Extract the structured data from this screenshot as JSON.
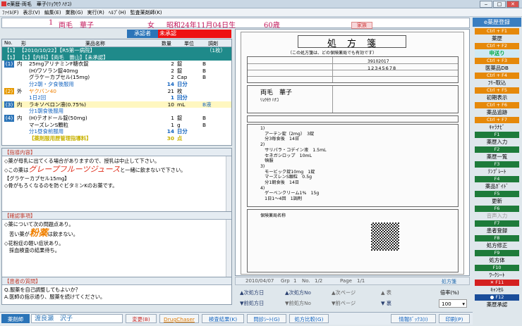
{
  "window": {
    "title": "e薬歴-両毛　華子(ﾘｮｳﾓｳ ﾊﾅｺ)",
    "min": "‒",
    "max": "□",
    "close": "✕"
  },
  "menu": [
    "ﾌｧｲﾙ(F)",
    "表示(V)",
    "編集(E)",
    "業務(G)",
    "実行(R)",
    "ﾍﾙﾌﾟ(H)",
    "監査薬剤師(K)"
  ],
  "patient": {
    "no": "1",
    "name": "両毛　華子",
    "sex": "女",
    "dob": "昭和24年11月04日生",
    "age": "60歳",
    "family": "家族"
  },
  "approval": {
    "label": "承認者",
    "value": "未承認"
  },
  "rx": {
    "headers": {
      "no": "No.",
      "kind": "形",
      "name": "薬品名称",
      "qty": "数量",
      "unit": "単位",
      "adj": "調剤"
    },
    "rows": [
      {
        "no": "【1】",
        "kind": "",
        "name": "【2010/10/22】【R5第一病院】",
        "qty": "",
        "unit": "",
        "adj": "（1枚）",
        "style": "teal"
      },
      {
        "no": "【1】",
        "kind": "",
        "name": "【1】【内科】【両毛　蕾山】【未承認】",
        "qty": "",
        "unit": "",
        "adj": "",
        "style": "teal"
      },
      {
        "no": "(1)",
        "kind": "内",
        "name": "25mgアリナミンF糖衣錠",
        "qty": "2",
        "unit": "錠",
        "adj": "B",
        "style": "nb-blue"
      },
      {
        "no": "",
        "kind": "",
        "name": "(H)ワソラン錠40mg",
        "qty": "2",
        "unit": "錠",
        "adj": "B",
        "style": ""
      },
      {
        "no": "",
        "kind": "",
        "name": "グラケーカプセル(15mg)",
        "qty": "2",
        "unit": "Cap",
        "adj": "B",
        "style": ""
      },
      {
        "no": "",
        "kind": "",
        "name": "分2朝・夕食後服用",
        "qty": "14",
        "unit": "日分",
        "adj": "",
        "style": "blue"
      },
      {
        "no": "(2)",
        "kind": "外",
        "name": "ヤクバン40",
        "qty": "21",
        "unit": "枚",
        "adj": "",
        "style": "nb-or"
      },
      {
        "no": "",
        "kind": "",
        "name": "1日2回",
        "qty": "1",
        "unit": "回分",
        "adj": "",
        "style": "blue"
      },
      {
        "no": "(3)",
        "kind": "内",
        "name": "ラキソベロン液(0.75%)",
        "qty": "10",
        "unit": "mL",
        "adj": "B液",
        "style": "nb-blue"
      },
      {
        "no": "",
        "kind": "",
        "name": "分1朝食後服用",
        "qty": "",
        "unit": "",
        "adj": "",
        "style": "blue"
      },
      {
        "no": "(4)",
        "kind": "内",
        "name": "(H)テオドール錠(50mg)",
        "qty": "1",
        "unit": "錠",
        "adj": "B",
        "style": "nb-blue"
      },
      {
        "no": "",
        "kind": "",
        "name": "マーズレンS顆粒",
        "qty": "1",
        "unit": "g",
        "adj": "B",
        "style": ""
      },
      {
        "no": "",
        "kind": "",
        "name": "分1昼食前服用",
        "qty": "14",
        "unit": "日分",
        "adj": "",
        "style": "blue"
      },
      {
        "no": "",
        "kind": "",
        "name": "【薬剤服用歴管理指導料】",
        "qty": "30",
        "unit": "点",
        "adj": "",
        "style": "gold"
      }
    ]
  },
  "instructions": {
    "title": "【指導内容】",
    "l1": "◇薬が母乳に出てくる場合がありますので、授乳は中止して下さい。",
    "l2a": "◇この薬は",
    "l2b": "グレープフルーツジュース",
    "l2c": "と一緒に飲まないで下さい。",
    "l3": "【グラケーカプセル15mg】",
    "l4": "◇骨がもろくなるのを防ぐビタミンKのお薬です。"
  },
  "confirm": {
    "title": "【確認事項】",
    "l1": "◇薬について次の問題点あり。",
    "l2a": "苦い薬が",
    "l2b": "粉薬",
    "l2c": "は飲まない。",
    "l3": "◇花粉症の軽い症状あり。",
    "l4": "採血検査の結果待ち。"
  },
  "question": {
    "title": "【患者の質問】",
    "l1": "Q.服薬を自己調整してもよいか？",
    "l2": "A.医師の指示通り、服薬を続けてください。"
  },
  "rxview": {
    "title": "処　方　箋",
    "subtitle": "（この処方箋は、どの保険薬局でも有効です）",
    "insurer": "39102017",
    "number": "12345678",
    "pname": "両毛　華子",
    "kana": "ﾘｮｳﾓｳ ﾊﾅｺ",
    "lines": [
      "1)　",
      "　アーテン錠（2mg）　3錠",
      "　分3毎食後　14日",
      "2)",
      "　サリパラ・コデイン液　1.5mL",
      "　セネガシロップ　10mL",
      "　頓服",
      "3)",
      "　モービック錠10mg　1錠",
      "　マーズレンS顆粒　0.5g",
      "　分1朝食後　14日",
      "4)",
      "　ゲーベンクリーム1%　15g",
      "　1日1〜4回　1調剤"
    ],
    "pharmacy": "保険薬局名称"
  },
  "pagebar": {
    "date": "2010/04/07",
    "grp": "Grp",
    "grpv": "1",
    "no": "No.",
    "nov": "1/2",
    "page": "Page",
    "pagev": "1/1",
    "kind": "処方箋"
  },
  "nav": {
    "next_day": "▲次処方日",
    "next_no": "▲次処方No",
    "next_page": "▲次ページ",
    "prev_day": "▼前処方日",
    "prev_no": "▼前処方No",
    "prev_page": "▼前ページ",
    "front": "▲ 表",
    "back": "▼ 裏",
    "zoom_label": "倍率(%)",
    "zoom": "100"
  },
  "right": {
    "title": "e薬歴登録",
    "items": [
      {
        "key": "Ctrl + F1",
        "label": "薬歴",
        "kc": "",
        "lc": ""
      },
      {
        "key": "Ctrl + F2",
        "label": "申送り",
        "kc": "",
        "lc": "sel"
      },
      {
        "key": "Ctrl + F3",
        "label": "医薬品DB",
        "kc": "",
        "lc": ""
      },
      {
        "key": "Ctrl + F4",
        "label": "ﾌﾘｰ取込",
        "kc": "",
        "lc": ""
      },
      {
        "key": "Ctrl + F5",
        "label": "初期表示",
        "kc": "",
        "lc": ""
      },
      {
        "key": "Ctrl + F6",
        "label": "薬品追跡",
        "kc": "",
        "lc": ""
      },
      {
        "key": "Ctrl + F7",
        "label": "ｷｬﾗﾅﾋﾞ",
        "kc": "",
        "lc": ""
      },
      {
        "key": "F1",
        "label": "薬歴入力",
        "kc": "g",
        "lc": ""
      },
      {
        "key": "F2",
        "label": "薬歴一覧",
        "kc": "g",
        "lc": ""
      },
      {
        "key": "F3",
        "label": "ﾃﾝﾌﾟﾚｰﾄ",
        "kc": "g",
        "lc": ""
      },
      {
        "key": "F4",
        "label": "薬品ｶﾞｲﾄﾞ",
        "kc": "g",
        "lc": ""
      },
      {
        "key": "F5",
        "label": "更新",
        "kc": "g",
        "lc": ""
      },
      {
        "key": "F6",
        "label": "音声入力",
        "kc": "g",
        "lc": "dim"
      },
      {
        "key": "F7",
        "label": "患者登録",
        "kc": "g",
        "lc": ""
      },
      {
        "key": "F8",
        "label": "処方修正",
        "kc": "g",
        "lc": ""
      },
      {
        "key": "F9",
        "label": "処方体",
        "kc": "g",
        "lc": ""
      },
      {
        "key": "F10",
        "label": "ﾜｰｸｼｰﾄ",
        "kc": "g",
        "lc": ""
      },
      {
        "key": "✕ F11",
        "label": "ｷｬﾝｾﾙ",
        "kc": "r",
        "lc": ""
      },
      {
        "key": "● F12",
        "label": "薬歴承認",
        "kc": "dk",
        "lc": ""
      }
    ]
  },
  "bottom": {
    "role": "薬剤師",
    "pharmacist": "渡良瀬　沢子",
    "change": "変更(B)",
    "chaser": "DrugChaser",
    "search": "検査結果(K)",
    "question": "問診ｼｰﾄ(G)",
    "compare": "処方比較(G)",
    "infobox": "情報ﾎﾞｯｸｽ(I)",
    "print": "印刷(P)"
  }
}
